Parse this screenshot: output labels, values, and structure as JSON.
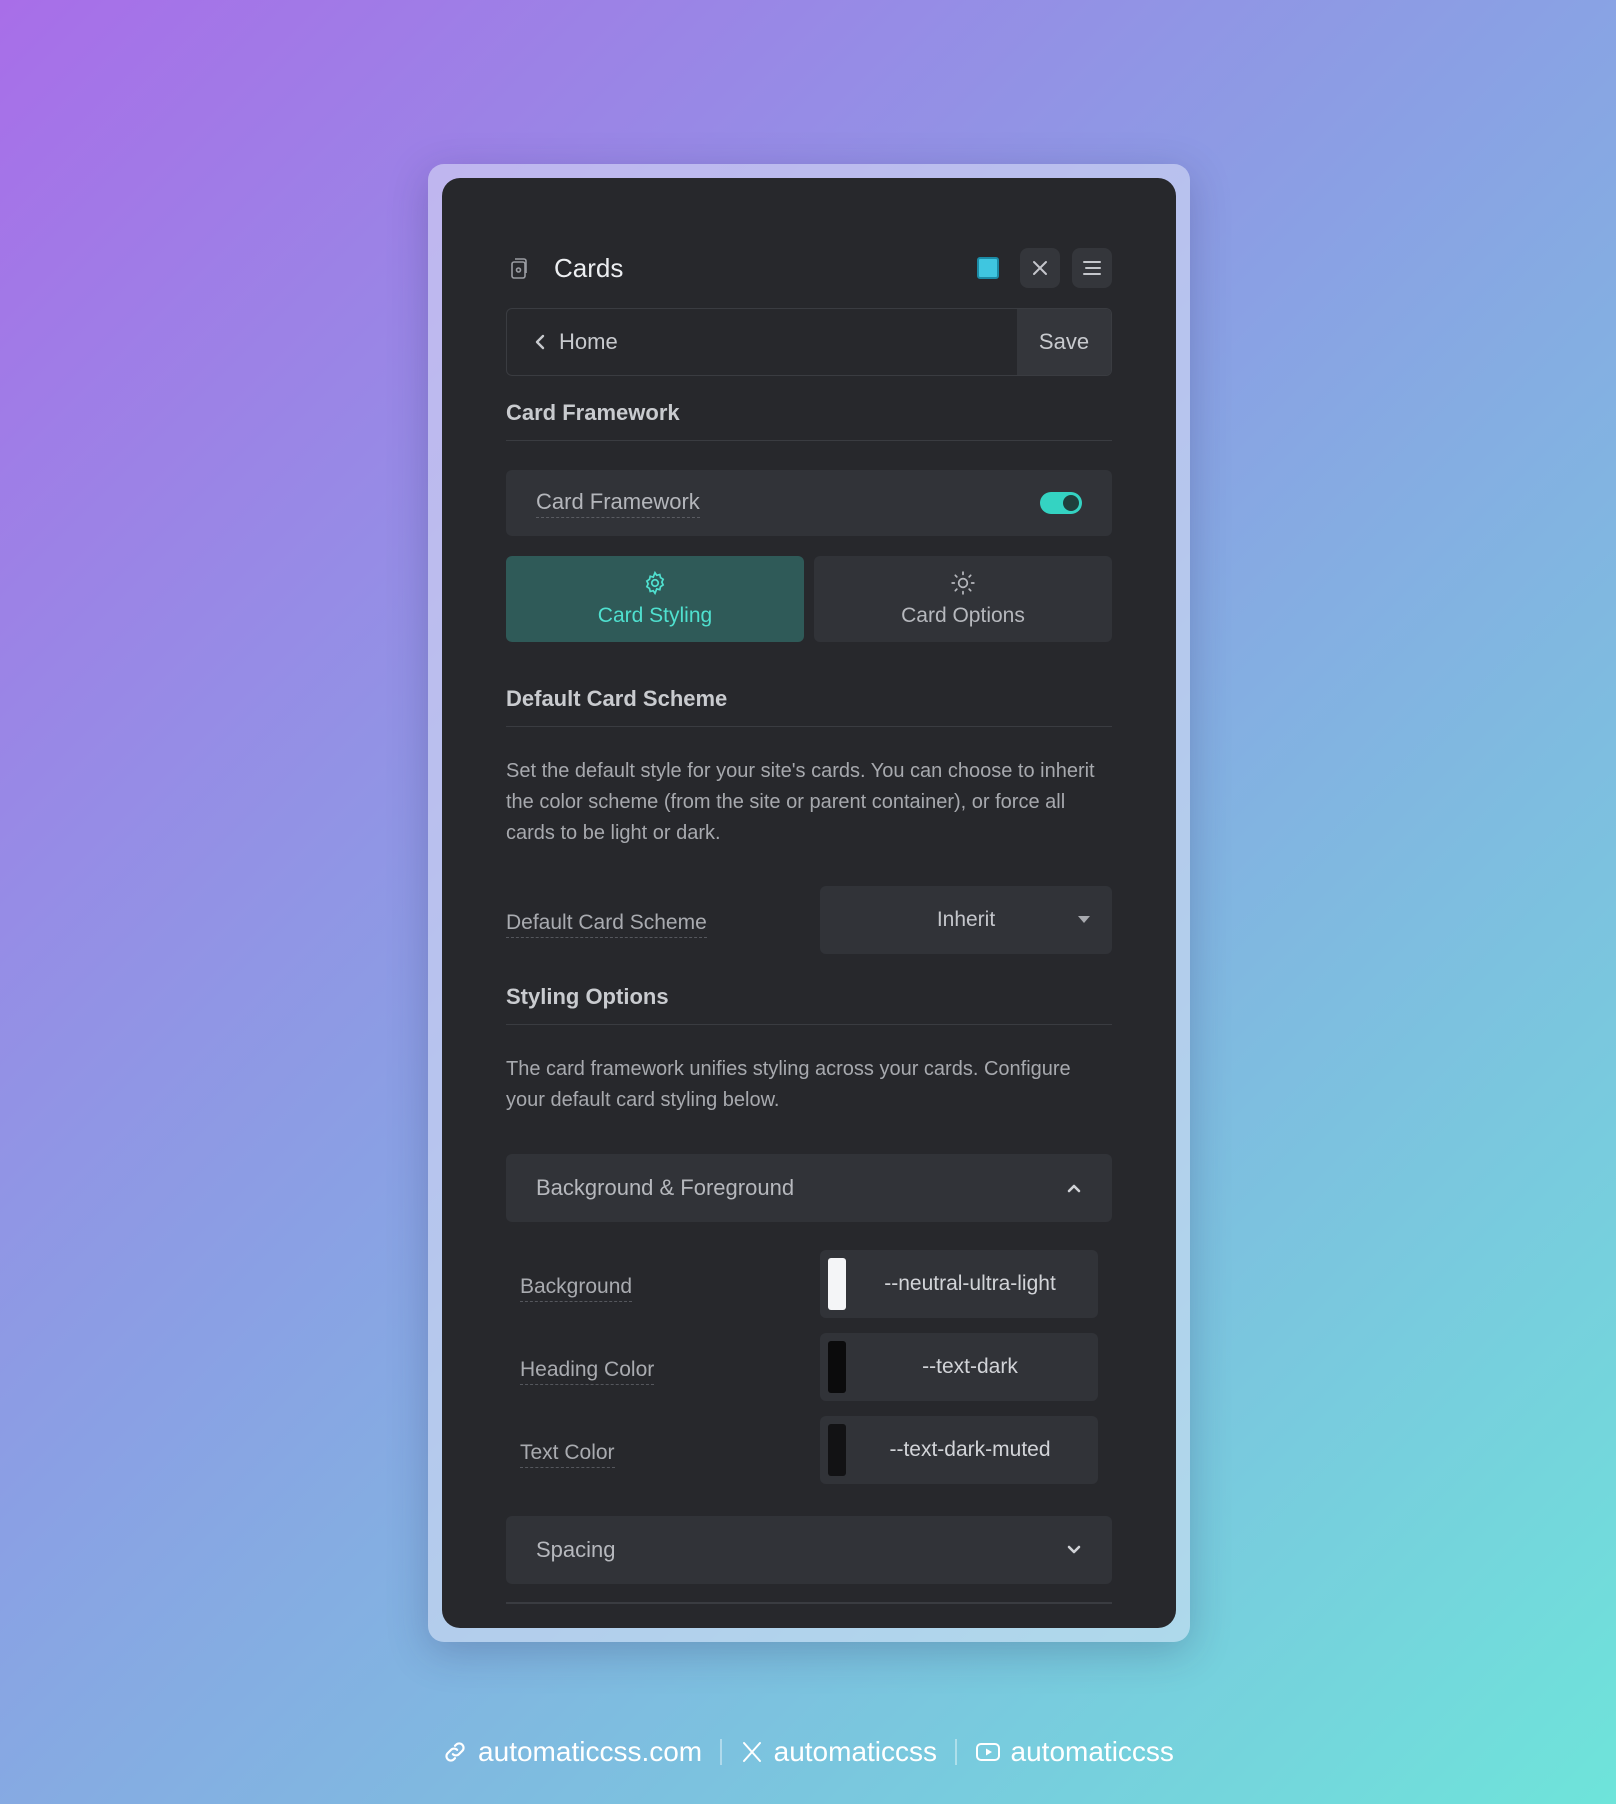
{
  "panel": {
    "title": "Cards",
    "app_icon": "cards-icon",
    "header_actions": [
      {
        "icon": "square-toggle-icon",
        "color": "#3fc6e0"
      },
      {
        "icon": "close-icon"
      },
      {
        "icon": "menu-icon"
      }
    ]
  },
  "nav": {
    "back_label": "Home",
    "save_label": "Save"
  },
  "card_framework": {
    "section_title": "Card Framework",
    "toggle_label": "Card Framework",
    "toggle_on": true,
    "accent": "#34d3c2"
  },
  "tabs": [
    {
      "label": "Card Styling",
      "icon": "gear-icon",
      "active": true
    },
    {
      "label": "Card Options",
      "icon": "sun-icon",
      "active": false
    }
  ],
  "scheme": {
    "section_title": "Default Card Scheme",
    "description": "Set the default style for your site's cards. You can choose to inherit the color scheme (from the site or parent container), or force all cards to be light or dark.",
    "field_label": "Default Card Scheme",
    "selected": "Inherit"
  },
  "styling": {
    "section_title": "Styling Options",
    "description": "The card framework unifies styling across your cards. Configure your default card styling below."
  },
  "accordions": {
    "bg_fg": {
      "label": "Background & Foreground",
      "expanded": true
    },
    "spacing": {
      "label": "Spacing",
      "expanded": false
    }
  },
  "colors": [
    {
      "label": "Background",
      "value": "--neutral-ultra-light",
      "swatch": "#f4f5f7"
    },
    {
      "label": "Heading Color",
      "value": "--text-dark",
      "swatch": "#0b0b0c"
    },
    {
      "label": "Text Color",
      "value": "--text-dark-muted",
      "swatch": "#121214"
    }
  ],
  "footer": [
    {
      "icon": "link-icon",
      "text": "automaticcss.com"
    },
    {
      "icon": "x-logo-icon",
      "text": "automaticcss"
    },
    {
      "icon": "youtube-icon",
      "text": "automaticcss"
    }
  ]
}
